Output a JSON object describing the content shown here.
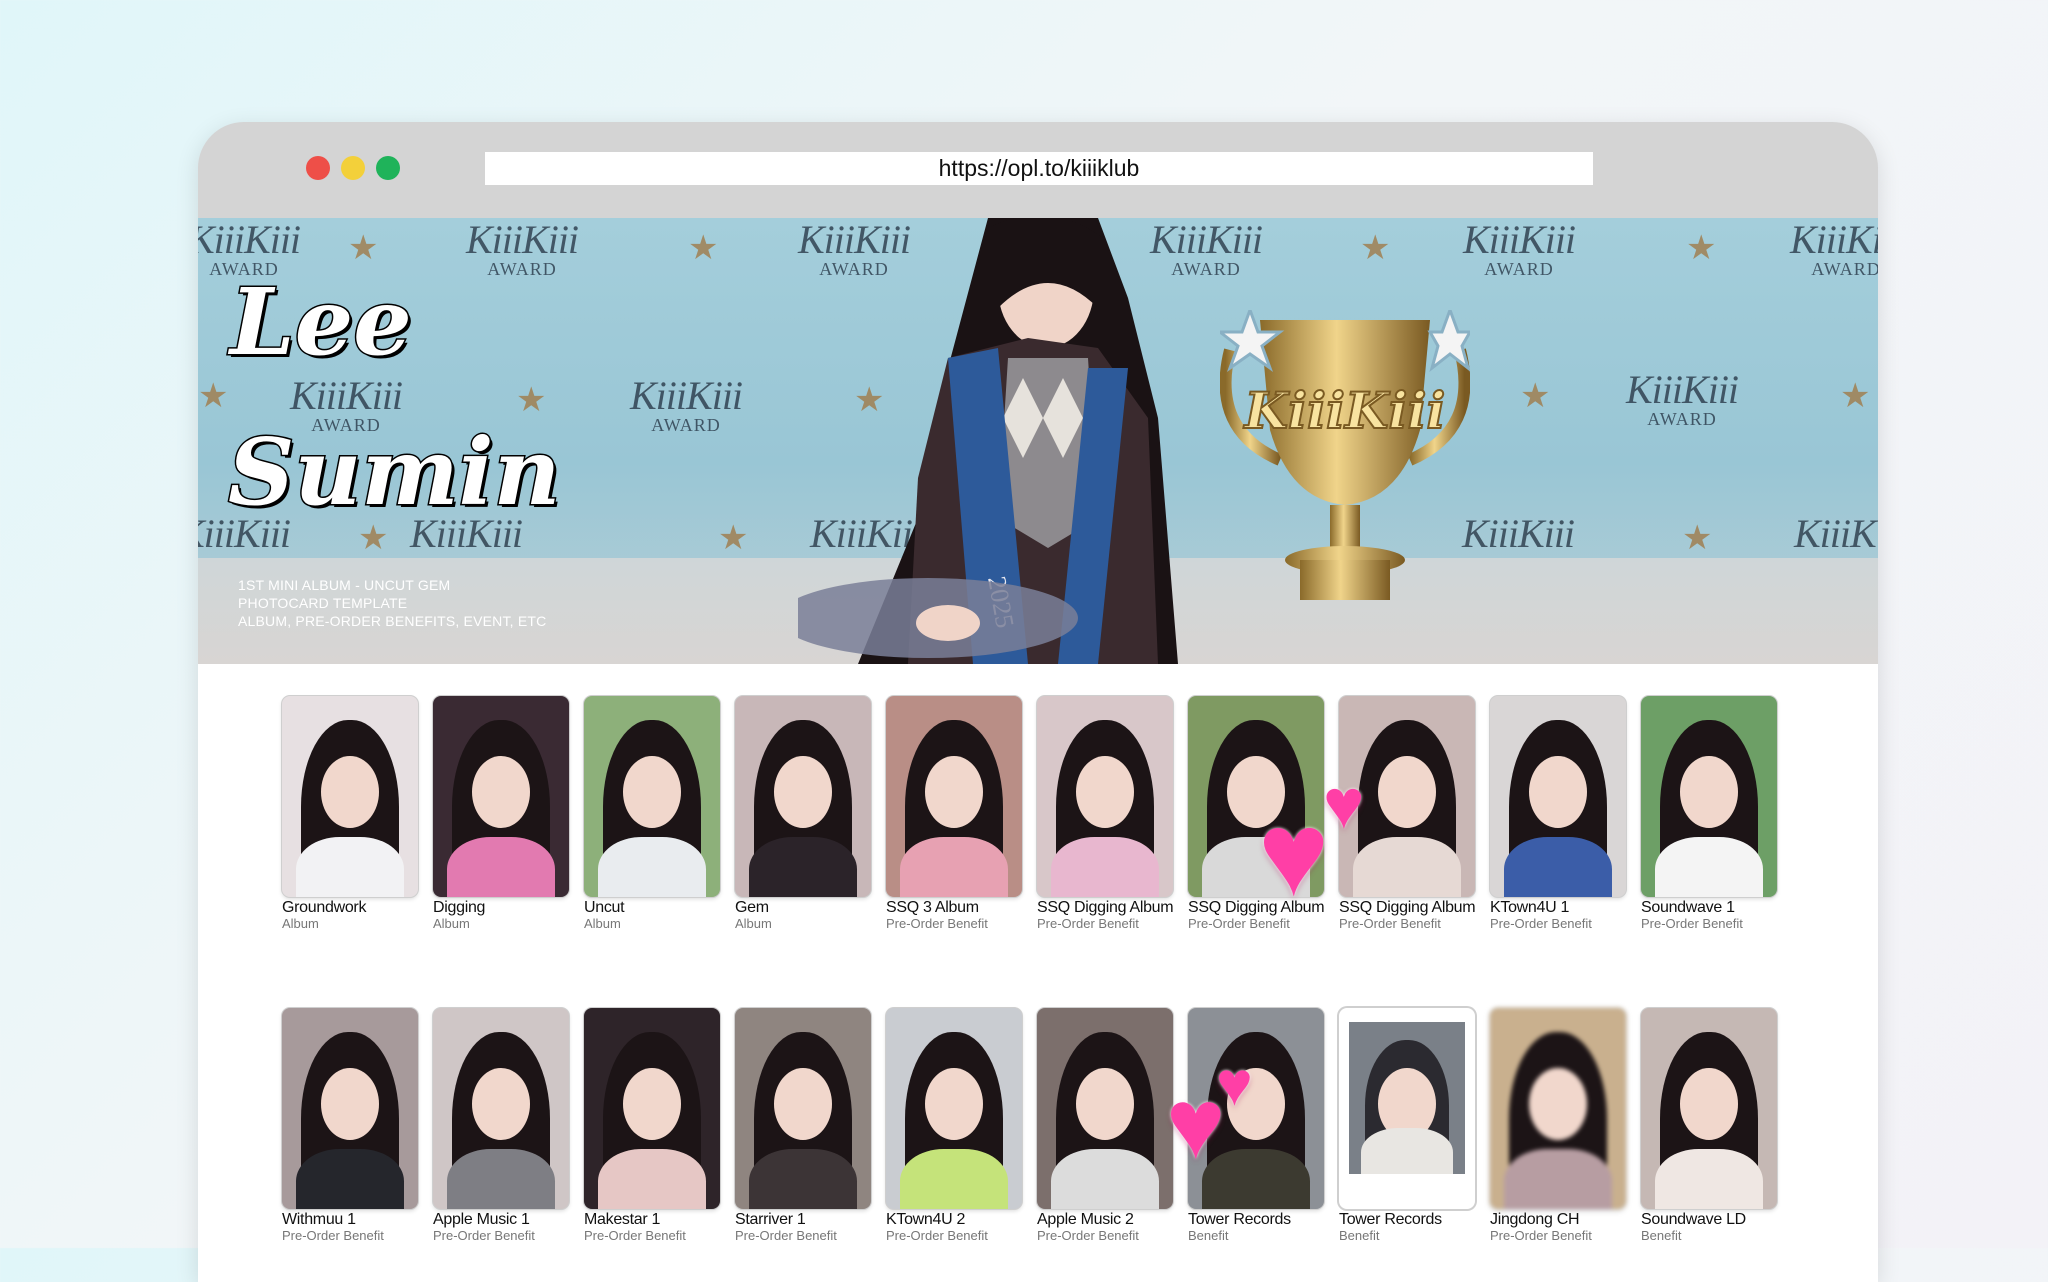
{
  "browser": {
    "url": "https://opl.to/kiiiklub"
  },
  "banner": {
    "title_line1": "Lee",
    "title_line2": "Sumin",
    "subtitle_lines": [
      "1ST MINI ALBUM - UNCUT GEM",
      "PHOTOCARD TEMPLATE",
      "ALBUM, PRE-ORDER BENEFITS, EVENT, ETC"
    ],
    "watermark_brand": "KiiiKiii",
    "watermark_award": "AWARD",
    "trophy_text": "KiiiKiii",
    "sash_text": "2025"
  },
  "cards": [
    {
      "title": "Groundwork",
      "subtitle": "Album",
      "colors": [
        "#e7e0e2",
        "#f2f2f4"
      ]
    },
    {
      "title": "Digging",
      "subtitle": "Album",
      "colors": [
        "#3a2a33",
        "#e27ab0"
      ]
    },
    {
      "title": "Uncut",
      "subtitle": "Album",
      "colors": [
        "#8db07a",
        "#e9ecef"
      ]
    },
    {
      "title": "Gem",
      "subtitle": "Album",
      "colors": [
        "#c8b7b8",
        "#2b2329"
      ]
    },
    {
      "title": "SSQ 3 Album",
      "subtitle": "Pre-Order Benefit",
      "colors": [
        "#b98e86",
        "#e7a1b2"
      ]
    },
    {
      "title": "SSQ Digging Album",
      "subtitle": "Pre-Order Benefit",
      "colors": [
        "#d8c7c9",
        "#e8b7cf"
      ]
    },
    {
      "title": "SSQ Digging Album",
      "subtitle": "Pre-Order Benefit",
      "colors": [
        "#7f9a62",
        "#d9d9d9"
      ]
    },
    {
      "title": "SSQ Digging Album",
      "subtitle": "Pre-Order Benefit",
      "colors": [
        "#c9b7b5",
        "#e6d9d4"
      ]
    },
    {
      "title": "KTown4U 1",
      "subtitle": "Pre-Order Benefit",
      "colors": [
        "#d9d6d6",
        "#3b5da8"
      ]
    },
    {
      "title": "Soundwave 1",
      "subtitle": "Pre-Order Benefit",
      "colors": [
        "#6d9f66",
        "#f4f4f4"
      ]
    },
    {
      "title": "Withmuu 1",
      "subtitle": "Pre-Order Benefit",
      "colors": [
        "#a79a9b",
        "#25262c"
      ]
    },
    {
      "title": "Apple Music 1",
      "subtitle": "Pre-Order Benefit",
      "colors": [
        "#cfc6c6",
        "#7e7e84"
      ]
    },
    {
      "title": "Makestar 1",
      "subtitle": "Pre-Order Benefit",
      "colors": [
        "#2e2429",
        "#e6c7c5"
      ]
    },
    {
      "title": "Starriver 1",
      "subtitle": "Pre-Order Benefit",
      "colors": [
        "#8f8580",
        "#3c3436"
      ]
    },
    {
      "title": "KTown4U 2",
      "subtitle": "Pre-Order Benefit",
      "colors": [
        "#c9ccd1",
        "#c5e37a"
      ]
    },
    {
      "title": "Apple Music 2",
      "subtitle": "Pre-Order Benefit",
      "colors": [
        "#7c6f6c",
        "#dcdcdc"
      ]
    },
    {
      "title": "Tower Records",
      "subtitle": "Benefit",
      "colors": [
        "#8c9096",
        "#3c3a30"
      ]
    },
    {
      "title": "Tower Records",
      "subtitle": "Benefit",
      "colors": [
        "#ffffff",
        "#7a8088"
      ]
    },
    {
      "title": "Jingdong CH",
      "subtitle": "Pre-Order Benefit",
      "colors": [
        "#c9b08e",
        "#b79da2"
      ]
    },
    {
      "title": "Soundwave LD",
      "subtitle": "Benefit",
      "colors": [
        "#c5b8b4",
        "#efe7e3"
      ]
    }
  ],
  "icons": {
    "window_close": "red-dot-icon",
    "window_minimize": "yellow-dot-icon",
    "window_maximize": "green-dot-icon",
    "sticker": "heart-icon"
  },
  "colors": {
    "heart": "#ff3fa6",
    "banner_bg": "#a4cedb"
  }
}
